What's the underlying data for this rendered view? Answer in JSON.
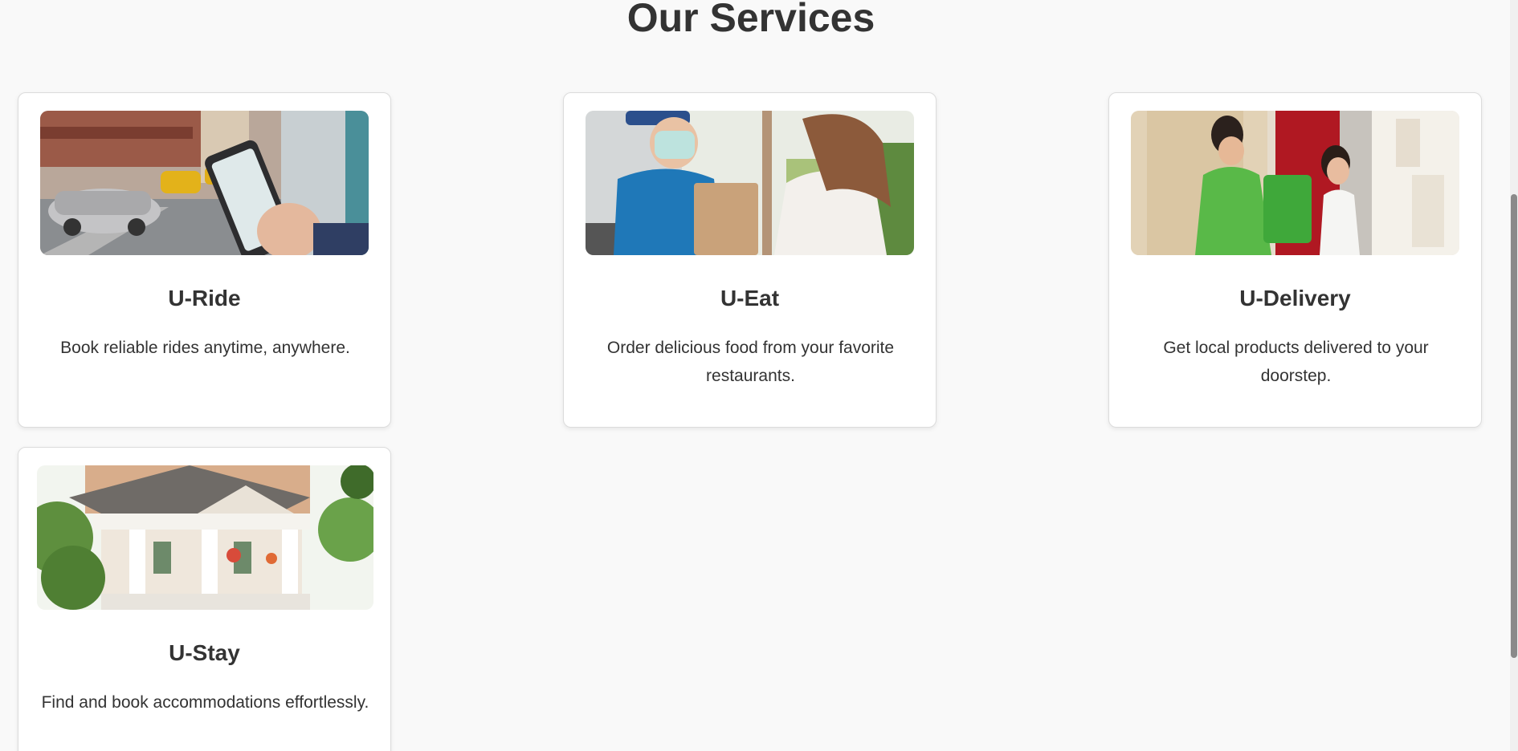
{
  "section": {
    "title": "Our Services"
  },
  "services": [
    {
      "name": "U-Ride",
      "description": "Book reliable rides anytime, anywhere.",
      "image_alt": "Hand holding smartphone with ride app on a city street"
    },
    {
      "name": "U-Eat",
      "description": "Order delicious food from your favorite restaurants.",
      "image_alt": "Masked courier handing a paper bag to a customer"
    },
    {
      "name": "U-Delivery",
      "description": "Get local products delivered to your doorstep.",
      "image_alt": "Courier in green shirt delivering a green grocery bag at a door"
    },
    {
      "name": "U-Stay",
      "description": "Find and book accommodations effortlessly.",
      "image_alt": "House with white porch and columns surrounded by trees"
    }
  ],
  "colors": {
    "background": "#f9f9f9",
    "card": "#ffffff",
    "text": "#333333",
    "scrollbar_thumb": "#8a8a8a"
  }
}
